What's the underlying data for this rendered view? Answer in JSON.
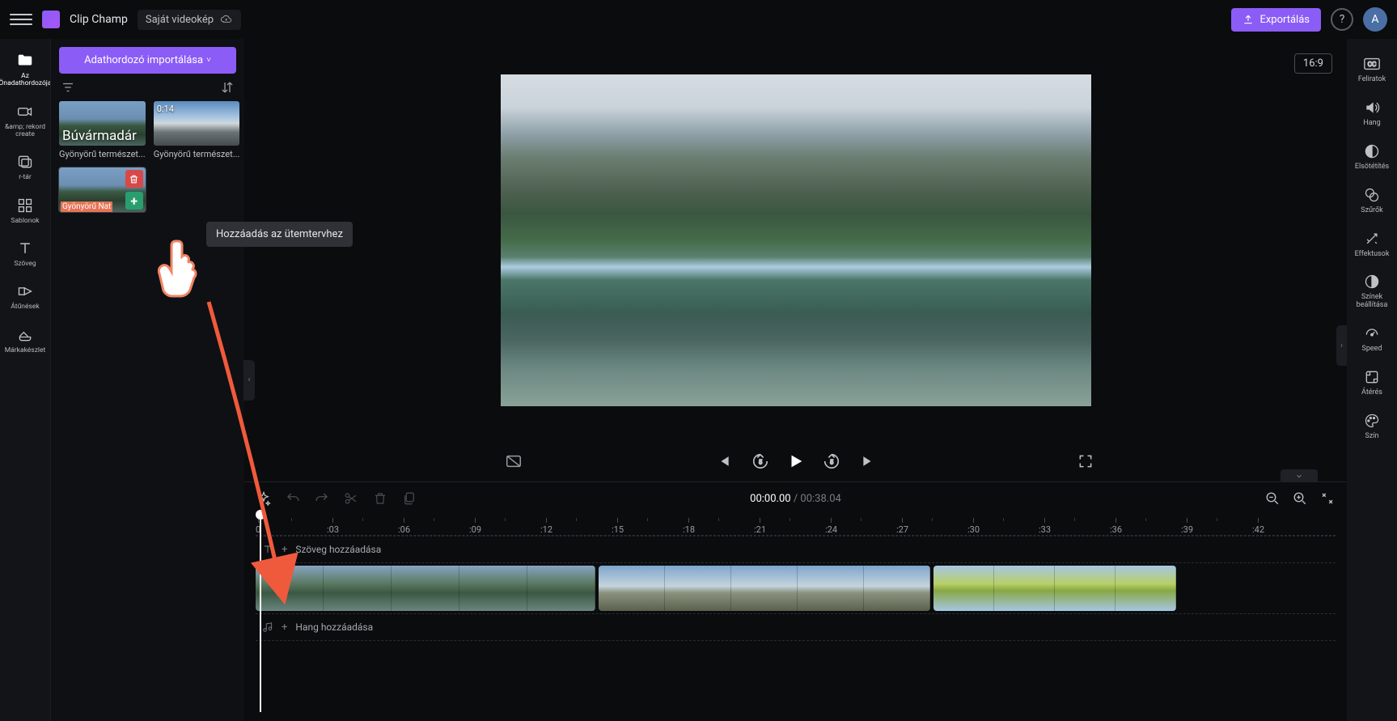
{
  "topbar": {
    "app_name": "Clip Champ",
    "project_name": "Saját videokép",
    "export_label": "Exportálás",
    "avatar_initial": "A"
  },
  "rail": {
    "items": [
      {
        "label": "Az Önadathordozója",
        "icon": "folder"
      },
      {
        "label": "&amp; rekord create",
        "icon": "camera"
      },
      {
        "label": "r-tár",
        "icon": "library"
      },
      {
        "label": "Sablonok",
        "icon": "templates"
      },
      {
        "label": "Szöveg",
        "icon": "text"
      },
      {
        "label": "Átűnések",
        "icon": "transitions"
      },
      {
        "label": "Márkakészlet",
        "icon": "brand"
      }
    ]
  },
  "media_panel": {
    "import_label": "Adathordozó importálása",
    "items": [
      {
        "title_overlay": "Búvármadár",
        "caption": "Gyönyörű természet..."
      },
      {
        "duration": "0:14",
        "caption": "Gyönyörű természet..."
      },
      {
        "hover_label": "Gyönyörű Nat"
      }
    ],
    "tooltip": "Hozzáadás az ütemtervhez"
  },
  "preview": {
    "aspect_label": "16:9"
  },
  "timeline": {
    "current_time": "00:00.00",
    "total_time": "00:38.04",
    "ticks": [
      "0",
      ":03",
      ":06",
      ":09",
      ":12",
      ":15",
      ":18",
      ":21",
      ":24",
      ":27",
      ":30",
      ":33",
      ":36",
      ":39",
      ":42"
    ],
    "text_track_label": "Szöveg hozzáadása",
    "audio_track_label": "Hang hozzáadása"
  },
  "prop_rail": {
    "items": [
      {
        "label": "Feliratok",
        "icon": "cc"
      },
      {
        "label": "Hang",
        "icon": "speaker"
      },
      {
        "label": "Elsötétítés",
        "icon": "fade"
      },
      {
        "label": "Szűrők",
        "icon": "filters"
      },
      {
        "label": "Effektusok",
        "icon": "effects"
      },
      {
        "label": "Színek beállítása",
        "icon": "colors"
      },
      {
        "label": "Speed",
        "icon": "speed"
      },
      {
        "label": "Átérés",
        "icon": "fit"
      },
      {
        "label": "Szín",
        "icon": "palette"
      }
    ]
  }
}
